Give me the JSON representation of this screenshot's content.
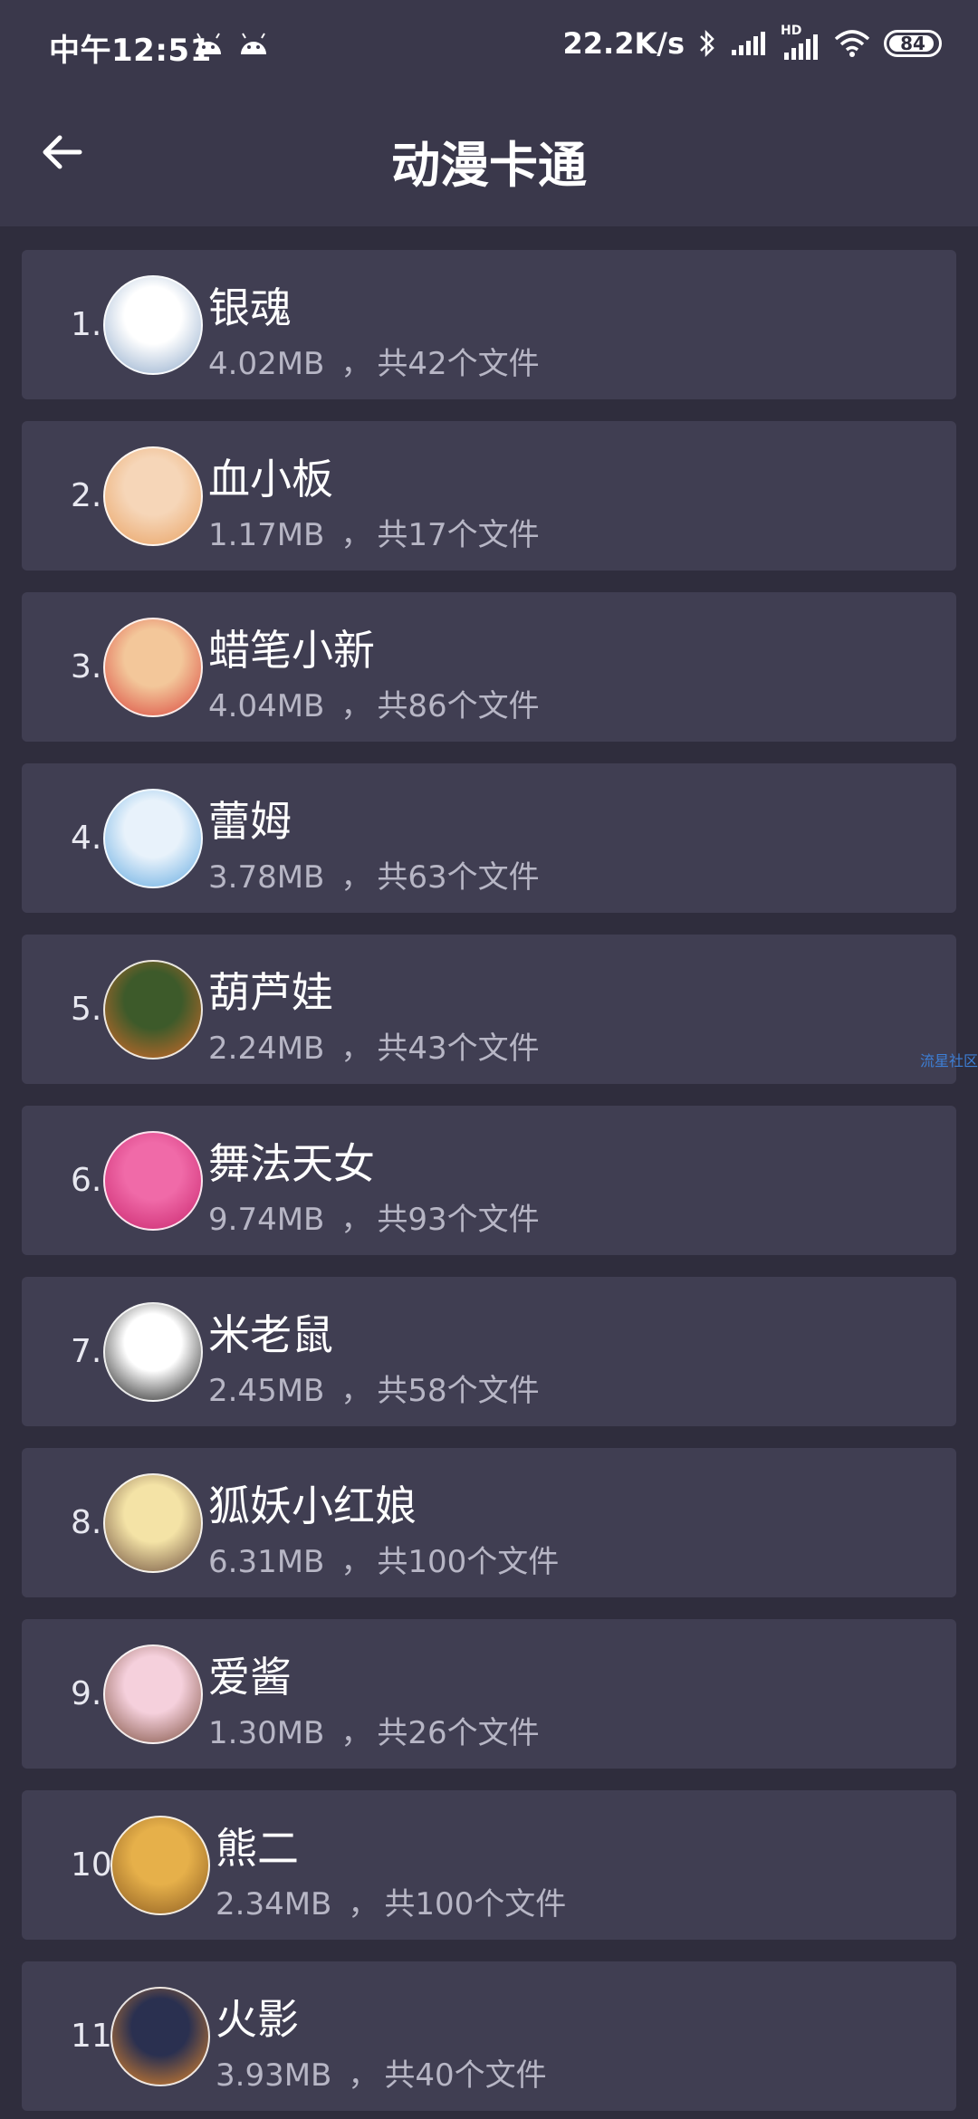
{
  "status_bar": {
    "time": "中午12:51",
    "speed": "22.2K/s",
    "hd_label": "HD",
    "battery": "84"
  },
  "header": {
    "title": "动漫卡通"
  },
  "list_separator": "，",
  "items": [
    {
      "index": "1.",
      "name": "银魂",
      "size": "4.02MB",
      "count": "共42个文件",
      "avatar_colors": [
        "#ffffff",
        "#8aa6c8"
      ]
    },
    {
      "index": "2.",
      "name": "血小板",
      "size": "1.17MB",
      "count": "共17个文件",
      "avatar_colors": [
        "#f6d6b8",
        "#e8a060"
      ]
    },
    {
      "index": "3.",
      "name": "蜡笔小新",
      "size": "4.04MB",
      "count": "共86个文件",
      "avatar_colors": [
        "#f3c79a",
        "#d9423a"
      ]
    },
    {
      "index": "4.",
      "name": "蕾姆",
      "size": "3.78MB",
      "count": "共63个文件",
      "avatar_colors": [
        "#e8f2fb",
        "#5fa8e0"
      ]
    },
    {
      "index": "5.",
      "name": "葫芦娃",
      "size": "2.24MB",
      "count": "共43个文件",
      "avatar_colors": [
        "#3d5a2a",
        "#d96b2a"
      ]
    },
    {
      "index": "6.",
      "name": "舞法天女",
      "size": "9.74MB",
      "count": "共93个文件",
      "avatar_colors": [
        "#f06aa8",
        "#c8246c"
      ]
    },
    {
      "index": "7.",
      "name": "米老鼠",
      "size": "2.45MB",
      "count": "共58个文件",
      "avatar_colors": [
        "#ffffff",
        "#111111"
      ]
    },
    {
      "index": "8.",
      "name": "狐妖小红娘",
      "size": "6.31MB",
      "count": "共100个文件",
      "avatar_colors": [
        "#f4e3a6",
        "#6a4a3a"
      ]
    },
    {
      "index": "9.",
      "name": "爱酱",
      "size": "1.30MB",
      "count": "共26个文件",
      "avatar_colors": [
        "#f5d0dc",
        "#7a4b3a"
      ]
    },
    {
      "index": "10.",
      "name": "熊二",
      "size": "2.34MB",
      "count": "共100个文件",
      "avatar_colors": [
        "#e6b04a",
        "#8a5a20"
      ]
    },
    {
      "index": "11.",
      "name": "火影",
      "size": "3.93MB",
      "count": "共40个文件",
      "avatar_colors": [
        "#2a3050",
        "#e8892a"
      ]
    }
  ],
  "watermark": "流星社区"
}
